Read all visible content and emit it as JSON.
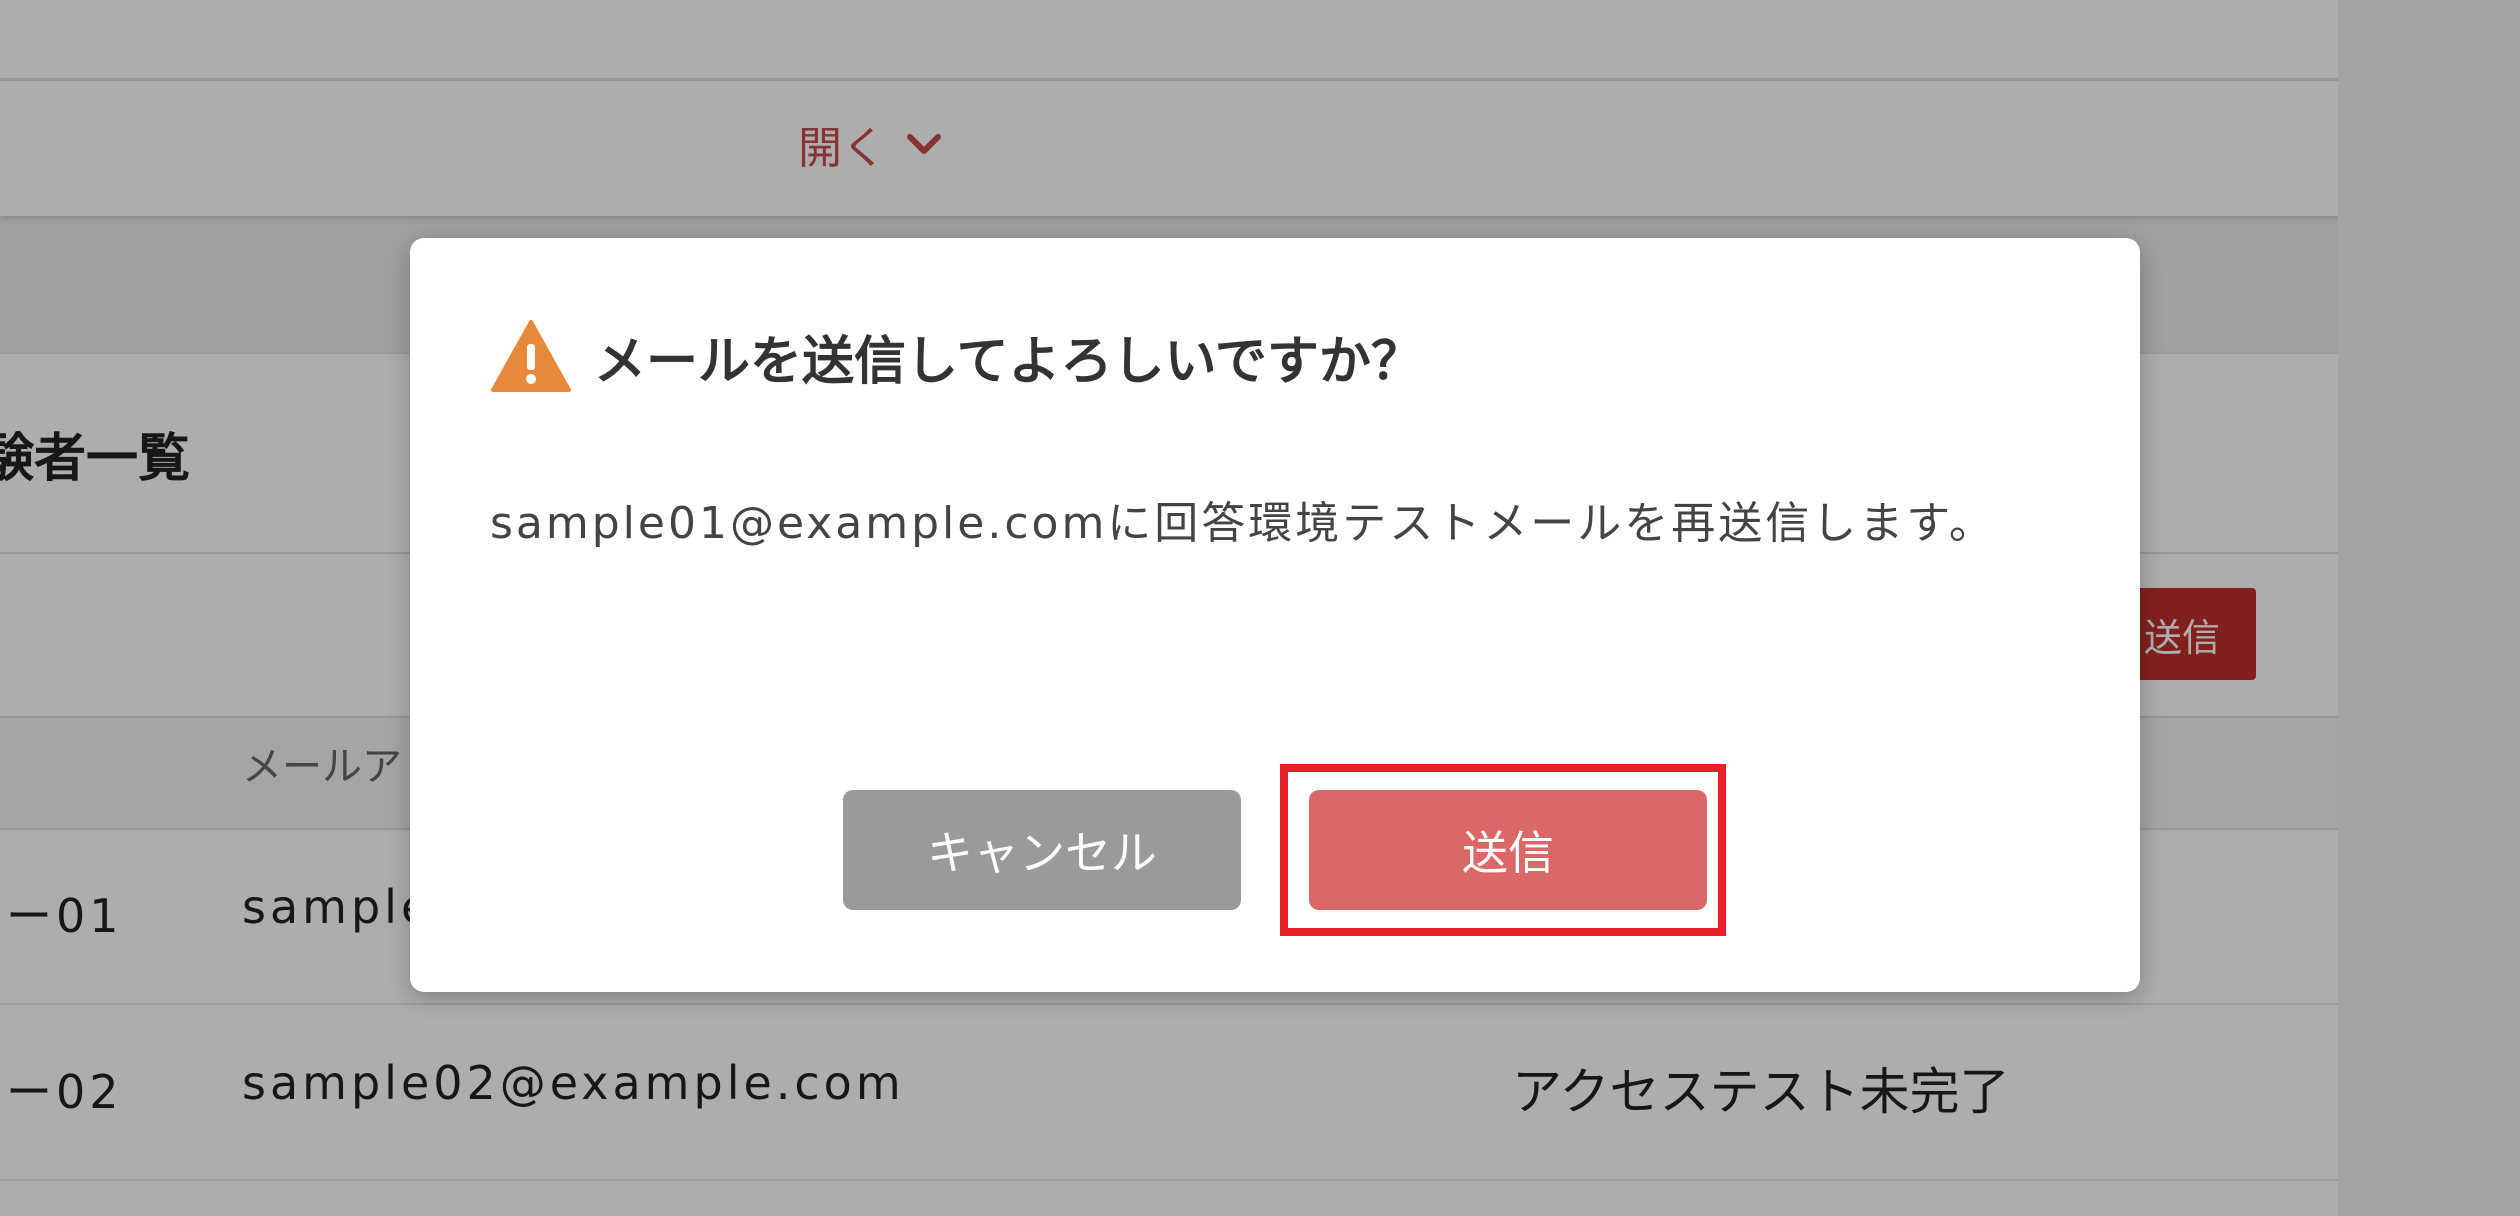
{
  "background": {
    "open_toggle_label": "開く",
    "list_title": "験者一覧",
    "bulk_send_label": "送信",
    "table_header_mail": "メールア",
    "rows": [
      {
        "id": "ー01",
        "mail": "sample",
        "status": ""
      },
      {
        "id": "ー02",
        "mail": "sample02@example.com",
        "status": "アクセステスト未完了"
      }
    ]
  },
  "dialog": {
    "title": "メールを送信してよろしいですか？",
    "message": "sample01@example.comに回答環境テストメールを再送信します。",
    "cancel_label": "キャンセル",
    "send_label": "送信"
  },
  "colors": {
    "accent_red": "#c94c4a",
    "send_button": "#d96866",
    "cancel_button": "#9a9a9a",
    "warning_icon": "#e8893a",
    "highlight_border": "#e8202a"
  }
}
